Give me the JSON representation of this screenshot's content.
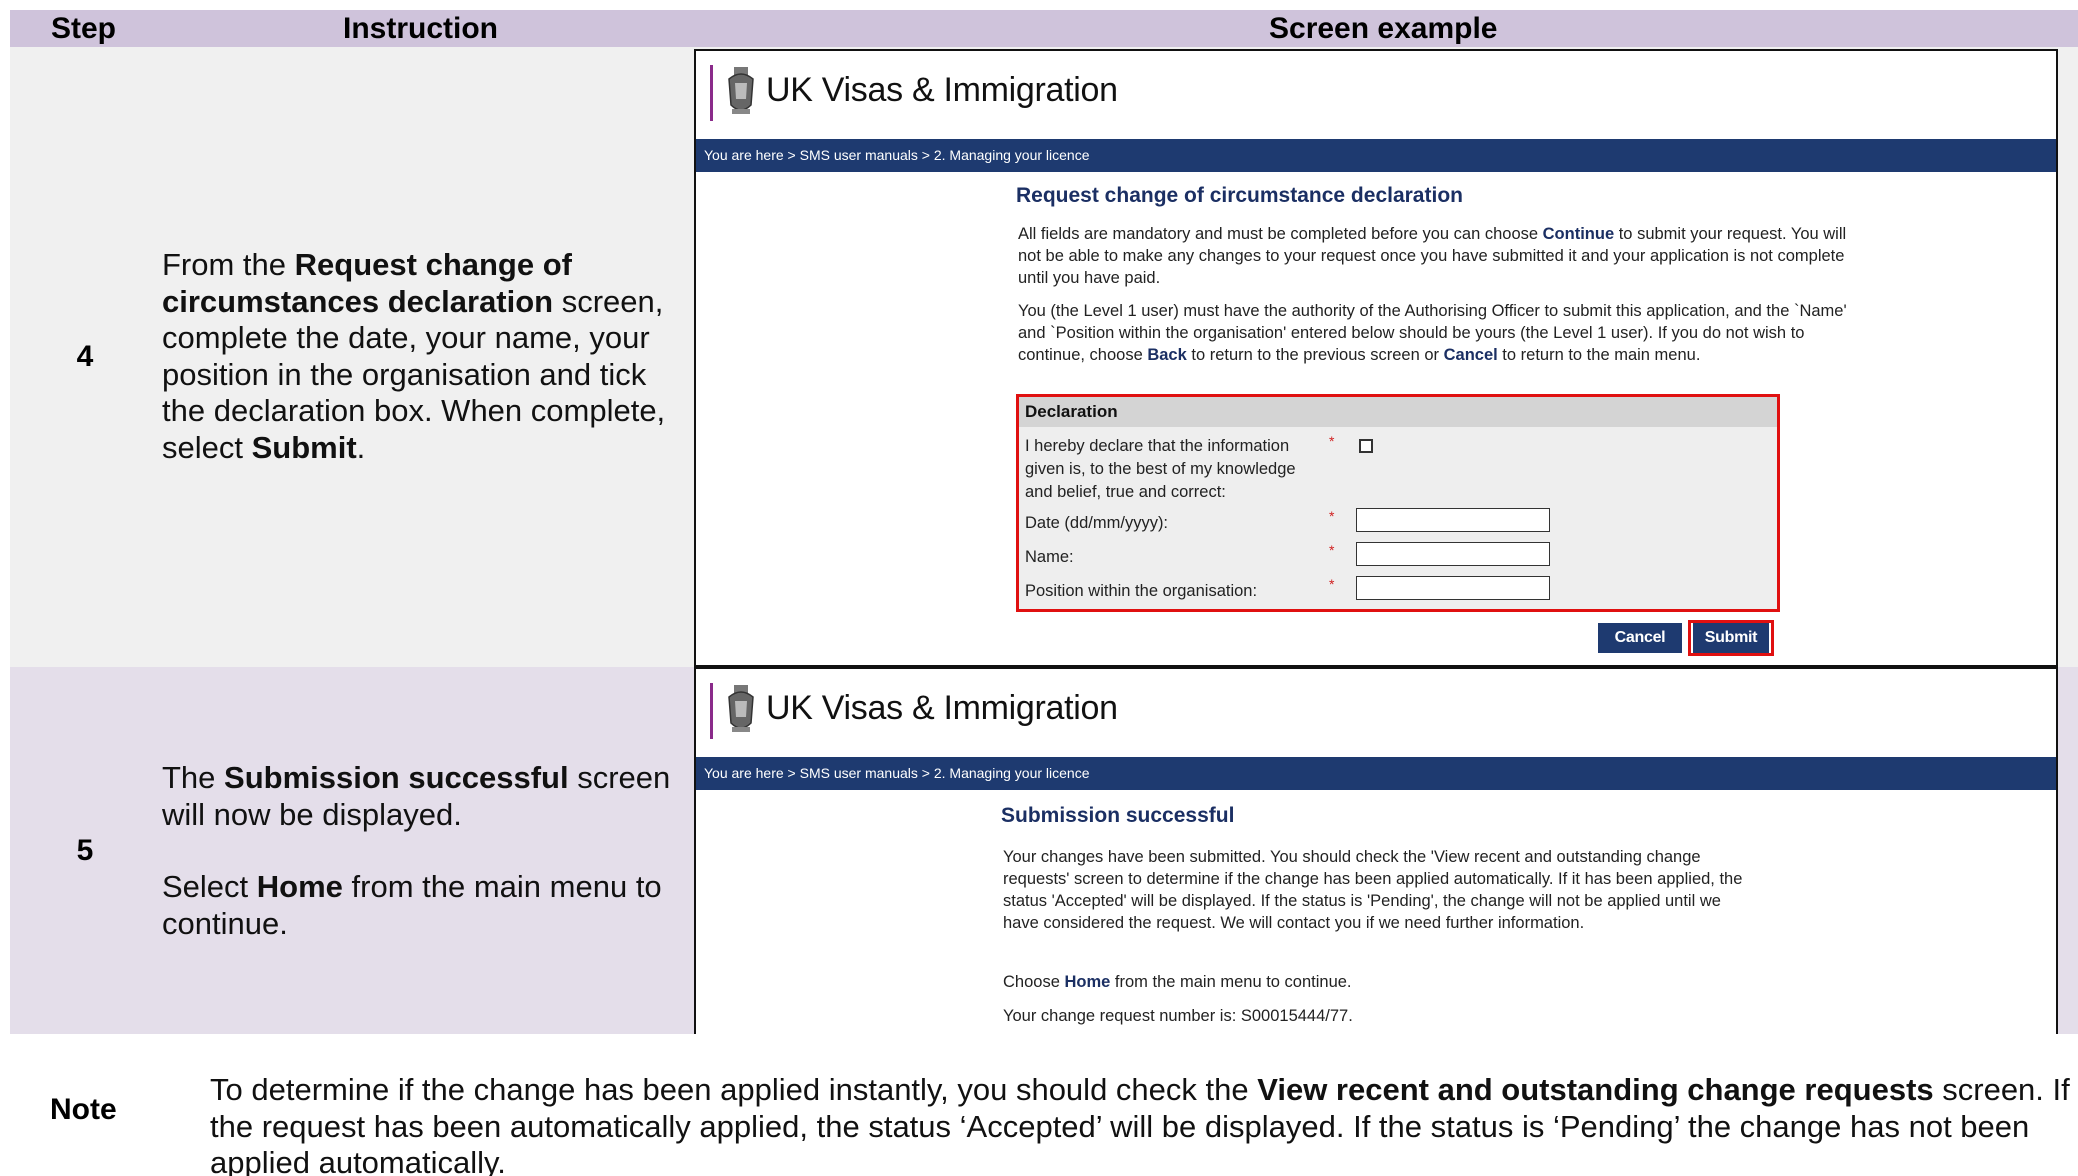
{
  "table": {
    "headers": {
      "step": "Step",
      "instruction": "Instruction",
      "screen": "Screen example"
    }
  },
  "row4": {
    "step": "4",
    "instruction": {
      "p1": "From the ",
      "b1": "Request change of circumstances declaration",
      "p2": " screen, complete the date, your name, your position in the organisation and tick the declaration box. When complete, select ",
      "b2": "Submit",
      "p3": "."
    },
    "screen": {
      "logo": "UK Visas & Immigration",
      "breadcrumb": "You are here > SMS user manuals > 2. Managing your licence",
      "title": "Request change of circumstance declaration",
      "para1_a": "All fields are mandatory and must be completed before you can choose ",
      "para1_b": "Continue",
      "para1_c": " to submit your request. You will not be able to make any changes to your request once you have submitted it and your application is not complete until you have paid.",
      "para2_a": "You (the Level 1 user) must have the authority of the Authorising Officer to submit this application, and the `Name' and `Position within the organisation' entered below should be yours (the Level 1 user). If you do not wish to continue, choose ",
      "para2_b": "Back",
      "para2_c": " to return to the previous screen or ",
      "para2_d": "Cancel",
      "para2_e": " to return to the main menu.",
      "declaration_heading": "Declaration",
      "declare_label": "I hereby declare that the information given is, to the best of my knowledge and belief, true and correct:",
      "date_label": "Date (dd/mm/yyyy):",
      "name_label": "Name:",
      "position_label": "Position within the organisation:",
      "required_mark": "*",
      "cancel": "Cancel",
      "submit": "Submit"
    }
  },
  "row5": {
    "step": "5",
    "instruction": {
      "p1": "The ",
      "b1": "Submission successful",
      "p2": " screen will now be displayed.",
      "p3": "Select ",
      "b2": "Home",
      "p4": " from the main menu to continue."
    },
    "screen": {
      "logo": "UK Visas & Immigration",
      "breadcrumb": "You are here > SMS user manuals > 2. Managing your licence",
      "title": "Submission successful",
      "para1": "Your changes have been submitted. You should check the 'View recent and outstanding change requests' screen to determine if the change has been applied automatically. If it has been applied, the status 'Accepted' will be displayed. If the status is 'Pending', the change will not be applied until we have considered the request. We will contact you if we need further information.",
      "para2_a": "Choose ",
      "para2_b": "Home",
      "para2_c": " from the main menu to continue.",
      "para3": "Your change request number is: S00015444/77."
    }
  },
  "note": {
    "label": "Note",
    "t1": "To determine if the change has been applied instantly, you should check the ",
    "b1": "View recent and outstanding change requests",
    "t2": " screen. If the request has been automatically applied, the status ‘Accepted’ will be displayed. If the status is ‘Pending’ the change has not been applied automatically."
  },
  "colors": {
    "header_bg": "#cfc3db",
    "row4_bg": "#f0f0f0",
    "row5_bg": "#e4deea",
    "nav_blue": "#1e3a70",
    "highlight_red": "#e01010"
  }
}
